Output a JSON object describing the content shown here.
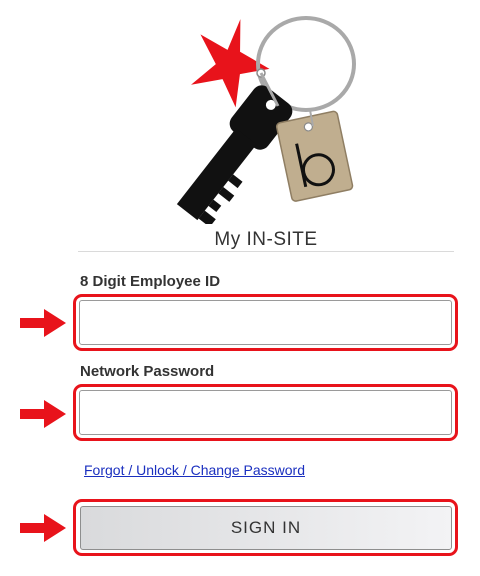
{
  "header": {
    "logo_letter": "b",
    "title": "My IN-SITE"
  },
  "form": {
    "employee_id": {
      "label": "8 Digit Employee ID",
      "value": "",
      "placeholder": ""
    },
    "password": {
      "label": "Network Password",
      "value": "",
      "placeholder": ""
    },
    "forgot_link": "Forgot / Unlock / Change Password",
    "signin_label": "SIGN IN"
  },
  "annotations": {
    "highlight_color": "#e8131b",
    "arrow_color": "#e8131b"
  },
  "colors": {
    "star": "#e8131b",
    "key": "#111111",
    "tag": "#c0ae8f",
    "ring": "#a9a9a9"
  }
}
